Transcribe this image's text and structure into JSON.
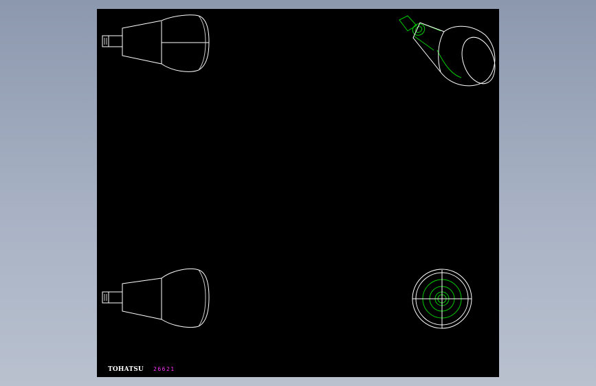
{
  "title_block": {
    "brand": "TOHATSU",
    "code": "26621"
  },
  "colors": {
    "background": "#9aa4b8",
    "sheet": "#000000",
    "outline": "#ffffff",
    "hidden_lines": "#00cc00",
    "code_text": "#ff33ff"
  },
  "views": [
    "side-view-top",
    "isometric-view",
    "side-view-bottom",
    "end-view"
  ]
}
